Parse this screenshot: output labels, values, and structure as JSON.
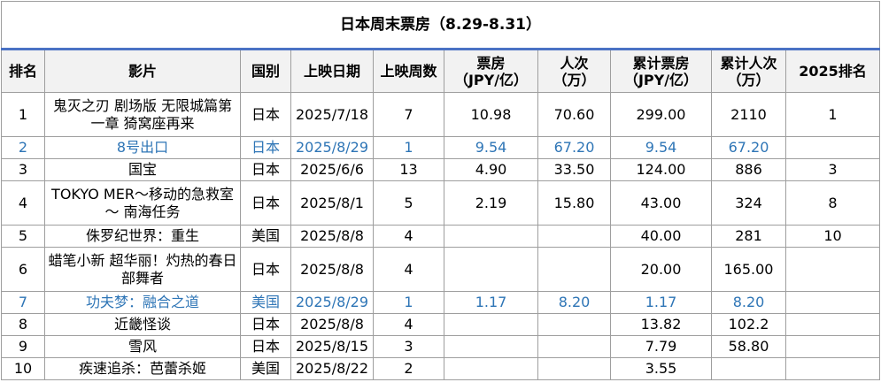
{
  "title": "日本周末票房（8.29-8.31）",
  "headers": {
    "rank": "排名",
    "film": "影片",
    "country": "国别",
    "release": "上映日期",
    "weeks": "上映周数",
    "box_l1": "票房",
    "box_l2": "（JPY/亿）",
    "adm_l1": "人次",
    "adm_l2": "（万）",
    "cum_box_l1": "累计票房",
    "cum_box_l2": "（JPY/亿）",
    "cum_adm_l1": "累计人次",
    "cum_adm_l2": "（万）",
    "rank2025": "2025排名"
  },
  "rows": [
    {
      "rank": "1",
      "film": "鬼灭之刃 剧场版 无限城篇第一章 猗窝座再来",
      "country": "日本",
      "release": "2025/7/18",
      "weeks": "7",
      "box": "10.98",
      "adm": "70.60",
      "cum_box": "299.00",
      "cum_adm": "2110",
      "rank2025": "1"
    },
    {
      "rank": "2",
      "film": "8号出口",
      "country": "日本",
      "release": "2025/8/29",
      "weeks": "1",
      "box": "9.54",
      "adm": "67.20",
      "cum_box": "9.54",
      "cum_adm": "67.20",
      "rank2025": ""
    },
    {
      "rank": "3",
      "film": "国宝",
      "country": "日本",
      "release": "2025/6/6",
      "weeks": "13",
      "box": "4.90",
      "adm": "33.50",
      "cum_box": "124.00",
      "cum_adm": "886",
      "rank2025": "3"
    },
    {
      "rank": "4",
      "film": "TOKYO MER～移动的急救室～ 南海任务",
      "country": "日本",
      "release": "2025/8/1",
      "weeks": "5",
      "box": "2.19",
      "adm": "15.80",
      "cum_box": "43.00",
      "cum_adm": "324",
      "rank2025": "8"
    },
    {
      "rank": "5",
      "film": "侏罗纪世界：重生",
      "country": "美国",
      "release": "2025/8/8",
      "weeks": "4",
      "box": "",
      "adm": "",
      "cum_box": "40.00",
      "cum_adm": "281",
      "rank2025": "10"
    },
    {
      "rank": "6",
      "film": "蜡笔小新 超华丽！灼热的春日部舞者",
      "country": "日本",
      "release": "2025/8/8",
      "weeks": "4",
      "box": "",
      "adm": "",
      "cum_box": "20.00",
      "cum_adm": "165.00",
      "rank2025": ""
    },
    {
      "rank": "7",
      "film": "功夫梦：融合之道",
      "country": "美国",
      "release": "2025/8/29",
      "weeks": "1",
      "box": "1.17",
      "adm": "8.20",
      "cum_box": "1.17",
      "cum_adm": "8.20",
      "rank2025": ""
    },
    {
      "rank": "8",
      "film": "近畿怪谈",
      "country": "日本",
      "release": "2025/8/8",
      "weeks": "4",
      "box": "",
      "adm": "",
      "cum_box": "13.82",
      "cum_adm": "102.2",
      "rank2025": ""
    },
    {
      "rank": "9",
      "film": "雪风",
      "country": "日本",
      "release": "2025/8/15",
      "weeks": "3",
      "box": "",
      "adm": "",
      "cum_box": "7.79",
      "cum_adm": "58.80",
      "rank2025": ""
    },
    {
      "rank": "10",
      "film": "疾速追杀：芭蕾杀姬",
      "country": "美国",
      "release": "2025/8/22",
      "weeks": "2",
      "box": "",
      "adm": "",
      "cum_box": "3.55",
      "cum_adm": "",
      "rank2025": ""
    }
  ],
  "highlight_color": "#2e75b6"
}
